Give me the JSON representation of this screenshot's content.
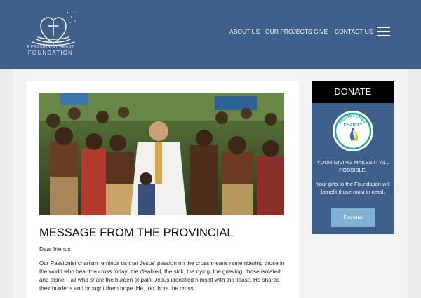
{
  "header": {
    "logo_line1": "A PASSIONIST HEART",
    "logo_line2": "FOUNDATION",
    "nav": [
      "ABOUT US",
      "OUR PROJECTS",
      "GIVE",
      "CONTACT US"
    ],
    "menu_icon": "hamburger-menu-icon"
  },
  "article": {
    "title": "MESSAGE FROM THE PROVINCIAL",
    "greeting": "Dear friends",
    "body": "Our Passionist charism reminds us that Jesus' passion on the cross means remembering those in the world who bear the cross today: the disabled, the sick, the dying, the grieving, those isolated and alone – all who share the burden of pain. Jesus identified himself with the 'least'. He shared their burdens and brought them hope. He, too, bore the cross."
  },
  "donate": {
    "heading": "DONATE",
    "badge_top": "REGISTERED",
    "badge_mid": "CHARITY",
    "tagline": "YOUR GIVING MAKES IT ALL POSSIBLE.",
    "subtext": "Your gifts to the Foundation will benefit those most in need.",
    "button": "Donate"
  },
  "colors": {
    "header_bg": "#3e5f89",
    "donate_panel": "#3e5f89",
    "donate_head": "#000000",
    "donate_button": "#7fb2d2",
    "page_bg": "#ececec"
  }
}
